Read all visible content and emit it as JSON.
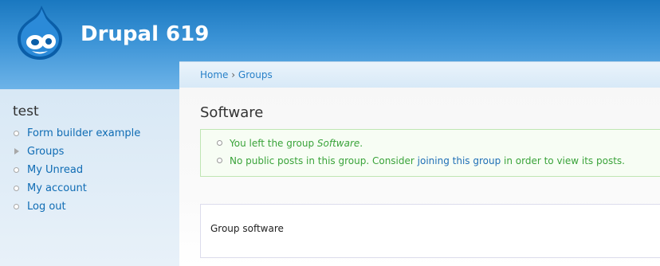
{
  "site": {
    "name": "Drupal 619"
  },
  "breadcrumb": {
    "home": "Home",
    "separator": "›",
    "current": "Groups"
  },
  "sidebar": {
    "title": "test",
    "items": [
      {
        "label": "Form builder example",
        "marker": "bullet"
      },
      {
        "label": "Groups",
        "marker": "collapsed-triangle"
      },
      {
        "label": "My Unread",
        "marker": "bullet"
      },
      {
        "label": "My account",
        "marker": "bullet"
      },
      {
        "label": "Log out",
        "marker": "bullet"
      }
    ]
  },
  "page": {
    "title": "Software",
    "messages": {
      "first_prefix": "You left the group ",
      "first_group": "Software",
      "first_suffix": ".",
      "second_prefix": "No public posts in this group. Consider ",
      "second_link": "joining this group",
      "second_suffix": " in order to view its posts."
    },
    "node_body": "Group software"
  },
  "colors": {
    "header_top": "#1a78c0",
    "link": "#0f6cb4",
    "status_text": "#3aa33a"
  }
}
